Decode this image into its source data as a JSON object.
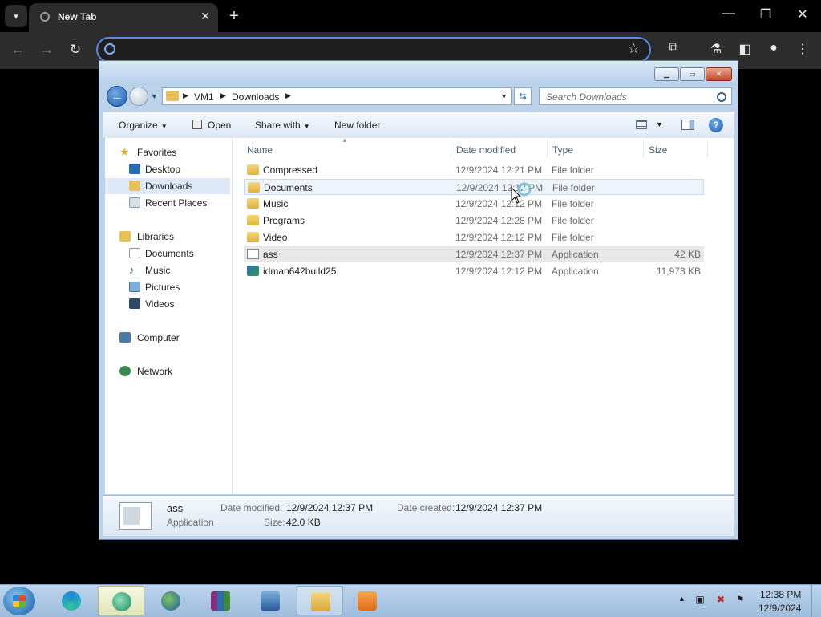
{
  "browser": {
    "tab_title": "New Tab",
    "close_glyph": "✕",
    "new_tab_glyph": "+",
    "window_controls": {
      "minimize": "—",
      "restore": "❐",
      "close": "✕"
    },
    "nav": {
      "back": "←",
      "forward": "→",
      "reload": "↻"
    },
    "omnibox_value": ""
  },
  "explorer": {
    "breadcrumb": [
      "VM1",
      "Downloads"
    ],
    "search_placeholder": "Search Downloads",
    "commands": {
      "organize": "Organize",
      "open": "Open",
      "share_with": "Share with",
      "new_folder": "New folder"
    },
    "nav_pane": {
      "favorites": {
        "label": "Favorites",
        "items": [
          "Desktop",
          "Downloads",
          "Recent Places"
        ]
      },
      "libraries": {
        "label": "Libraries",
        "items": [
          "Documents",
          "Music",
          "Pictures",
          "Videos"
        ]
      },
      "computer": "Computer",
      "network": "Network",
      "selected": "Downloads"
    },
    "columns": {
      "name": "Name",
      "date": "Date modified",
      "type": "Type",
      "size": "Size"
    },
    "files": [
      {
        "name": "Compressed",
        "date": "12/9/2024 12:21 PM",
        "type": "File folder",
        "size": "",
        "icon": "folder-icon"
      },
      {
        "name": "Documents",
        "date": "12/9/2024 12:12 PM",
        "type": "File folder",
        "size": "",
        "icon": "folder-icon"
      },
      {
        "name": "Music",
        "date": "12/9/2024 12:12 PM",
        "type": "File folder",
        "size": "",
        "icon": "folder-icon"
      },
      {
        "name": "Programs",
        "date": "12/9/2024 12:28 PM",
        "type": "File folder",
        "size": "",
        "icon": "folder-icon"
      },
      {
        "name": "Video",
        "date": "12/9/2024 12:12 PM",
        "type": "File folder",
        "size": "",
        "icon": "folder-icon"
      },
      {
        "name": "ass",
        "date": "12/9/2024 12:37 PM",
        "type": "Application",
        "size": "42 KB",
        "icon": "application-icon"
      },
      {
        "name": "idman642build25",
        "date": "12/9/2024 12:12 PM",
        "type": "Application",
        "size": "11,973 KB",
        "icon": "installer-icon"
      }
    ],
    "details": {
      "name": "ass",
      "type": "Application",
      "date_modified_label": "Date modified:",
      "date_modified": "12/9/2024 12:37 PM",
      "size_label": "Size:",
      "size": "42.0 KB",
      "date_created_label": "Date created:",
      "date_created": "12/9/2024 12:37 PM"
    }
  },
  "taskbar": {
    "pinned": [
      "start-button",
      "edge-icon",
      "browser-icon",
      "idm-icon",
      "winrar-icon",
      "computer-admin-icon",
      "explorer-icon",
      "media-player-icon"
    ],
    "clock_time": "12:38 PM",
    "clock_date": "12/9/2024"
  }
}
